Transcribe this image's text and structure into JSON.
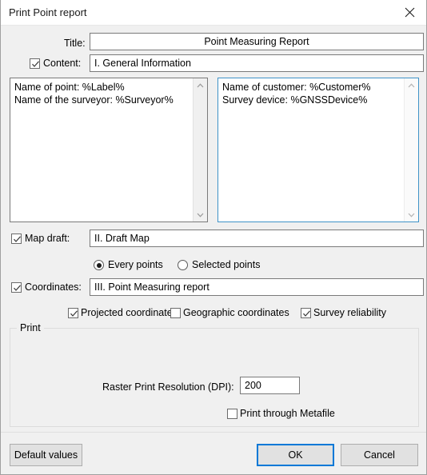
{
  "window": {
    "title": "Print Point report",
    "close_icon": "close-icon"
  },
  "form": {
    "title_label": "Title:",
    "title_value": "Point Measuring Report",
    "content_label": "Content:",
    "content_checked": true,
    "content_value": "I. General Information",
    "left_textarea": "Name of point: %Label%\nName of the surveyor: %Surveyor%",
    "right_textarea": "Name of customer: %Customer%\nSurvey device: %GNSSDevice%",
    "map_draft_label": "Map draft:",
    "map_draft_checked": true,
    "map_draft_value": "II. Draft Map",
    "radio_every_points": "Every points",
    "radio_selected_points": "Selected points",
    "radio_selected": "every",
    "coordinates_label": "Coordinates:",
    "coordinates_checked": true,
    "coordinates_value": "III. Point Measuring report",
    "projected_label": "Projected coordinates",
    "projected_checked": true,
    "geographic_label": "Geographic coordinates",
    "geographic_checked": false,
    "reliability_label": "Survey reliability",
    "reliability_checked": true
  },
  "print_group": {
    "legend": "Print",
    "dpi_label": "Raster Print Resolution (DPI):",
    "dpi_value": "200",
    "metafile_label": "Print through Metafile",
    "metafile_checked": false
  },
  "footer": {
    "default_values": "Default values",
    "ok": "OK",
    "cancel": "Cancel"
  },
  "colors": {
    "background": "#f0f0f0",
    "focus_blue": "#0078d7",
    "textarea_focus_border": "#3f93c8",
    "button_face": "#e1e1e1"
  }
}
